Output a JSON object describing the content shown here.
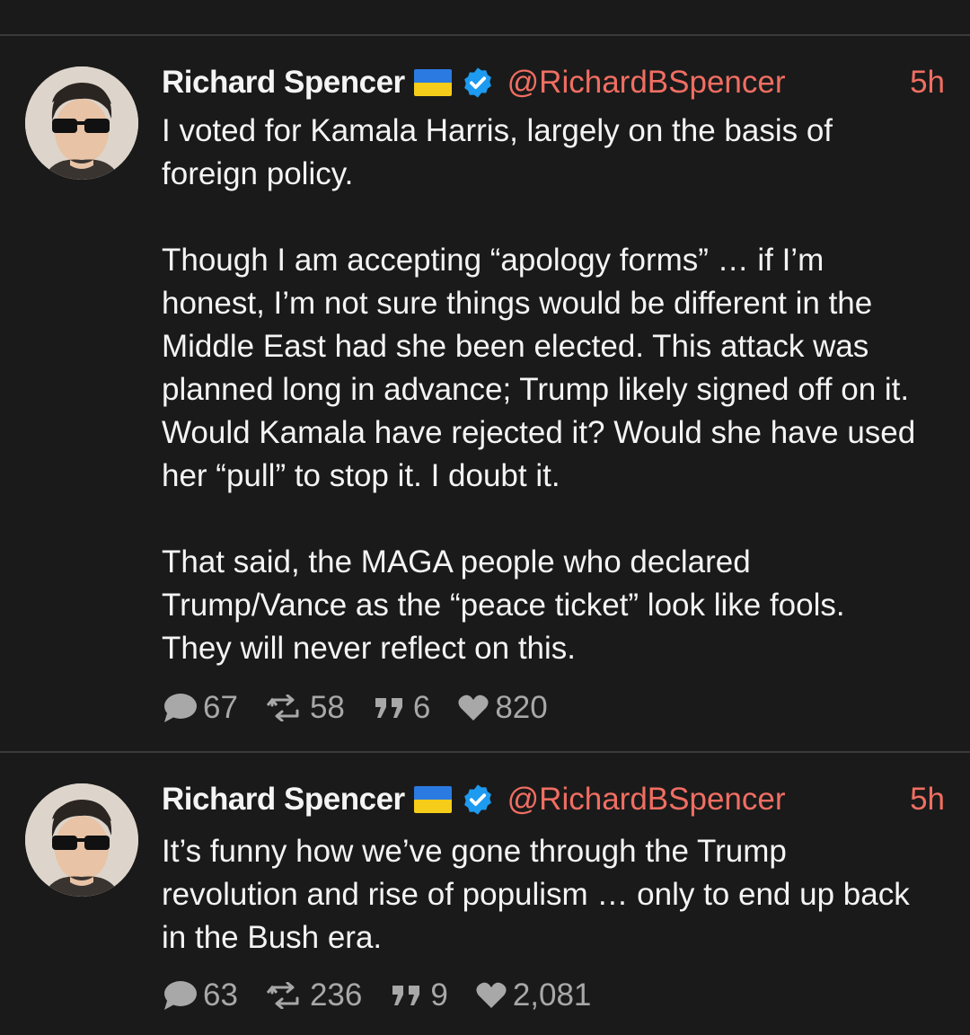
{
  "tweets": [
    {
      "name": "Richard Spencer",
      "handle": "@RichardBSpencer",
      "time": "5h",
      "text": "I voted for Kamala Harris, largely on the basis of\nforeign policy.\n\nThough I am accepting “apology forms” … if I’m\nhonest, I’m not sure things would be different in the\nMiddle East had she been elected. This attack was\nplanned long in advance; Trump likely signed off on it.\nWould Kamala have rejected it? Would she have used\nher “pull” to stop it. I doubt it.\n\nThat said, the MAGA people who declared\nTrump/Vance as the “peace ticket” look like fools.\nThey will never reflect on this.",
      "replies": "67",
      "reposts": "58",
      "quotes": "6",
      "likes": "820"
    },
    {
      "name": "Richard Spencer",
      "handle": "@RichardBSpencer",
      "time": "5h",
      "text": "It’s funny how we’ve gone through the Trump\nrevolution and rise of populism … only to end up back\nin the Bush era.",
      "replies": "63",
      "reposts": "236",
      "quotes": "9",
      "likes": "2,081"
    }
  ],
  "colors": {
    "background": "#1a1a1a",
    "accent": "#f06e62",
    "verified": "#1d9bf0",
    "muted": "#a8a8a8"
  },
  "icons": [
    "reply-icon",
    "repost-icon",
    "quote-icon",
    "like-icon",
    "verified-badge-icon",
    "ukraine-flag-icon"
  ]
}
